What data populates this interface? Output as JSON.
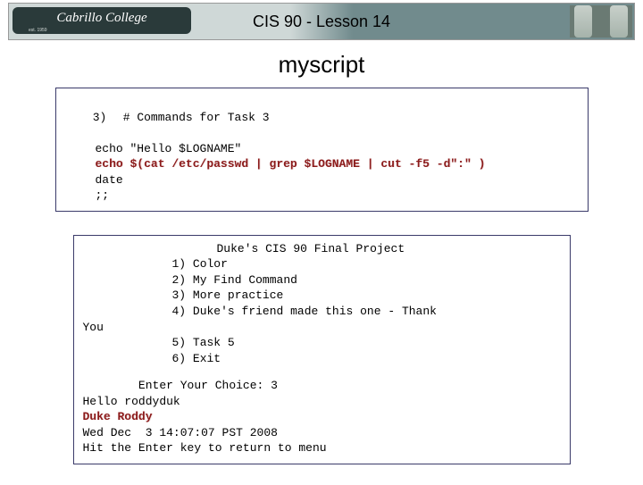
{
  "header": {
    "title": "CIS 90 - Lesson 14",
    "logo_text": "Cabrillo College"
  },
  "page": {
    "title": "myscript"
  },
  "code": {
    "case_label": "3)",
    "l1": "# Commands for Task 3",
    "l2": "echo \"Hello $LOGNAME\"",
    "l3": "echo $(cat /etc/passwd | grep $LOGNAME | cut -f5 -d\":\" )",
    "l4": "date",
    "l5": ";;"
  },
  "output": {
    "menu_title": "Duke's CIS 90 Final Project",
    "items": [
      "1) Color",
      "2) My Find Command",
      "3) More practice",
      "4) Duke's friend made this one - Thank",
      "5) Task 5",
      "6) Exit"
    ],
    "you": "You",
    "prompt": "        Enter Your Choice: 3",
    "hello": "Hello roddyduk",
    "name_hl": "Duke Roddy",
    "when": "Wed Dec  3 14:07:07 PST 2008",
    "hint": "Hit the Enter key to return to menu"
  }
}
